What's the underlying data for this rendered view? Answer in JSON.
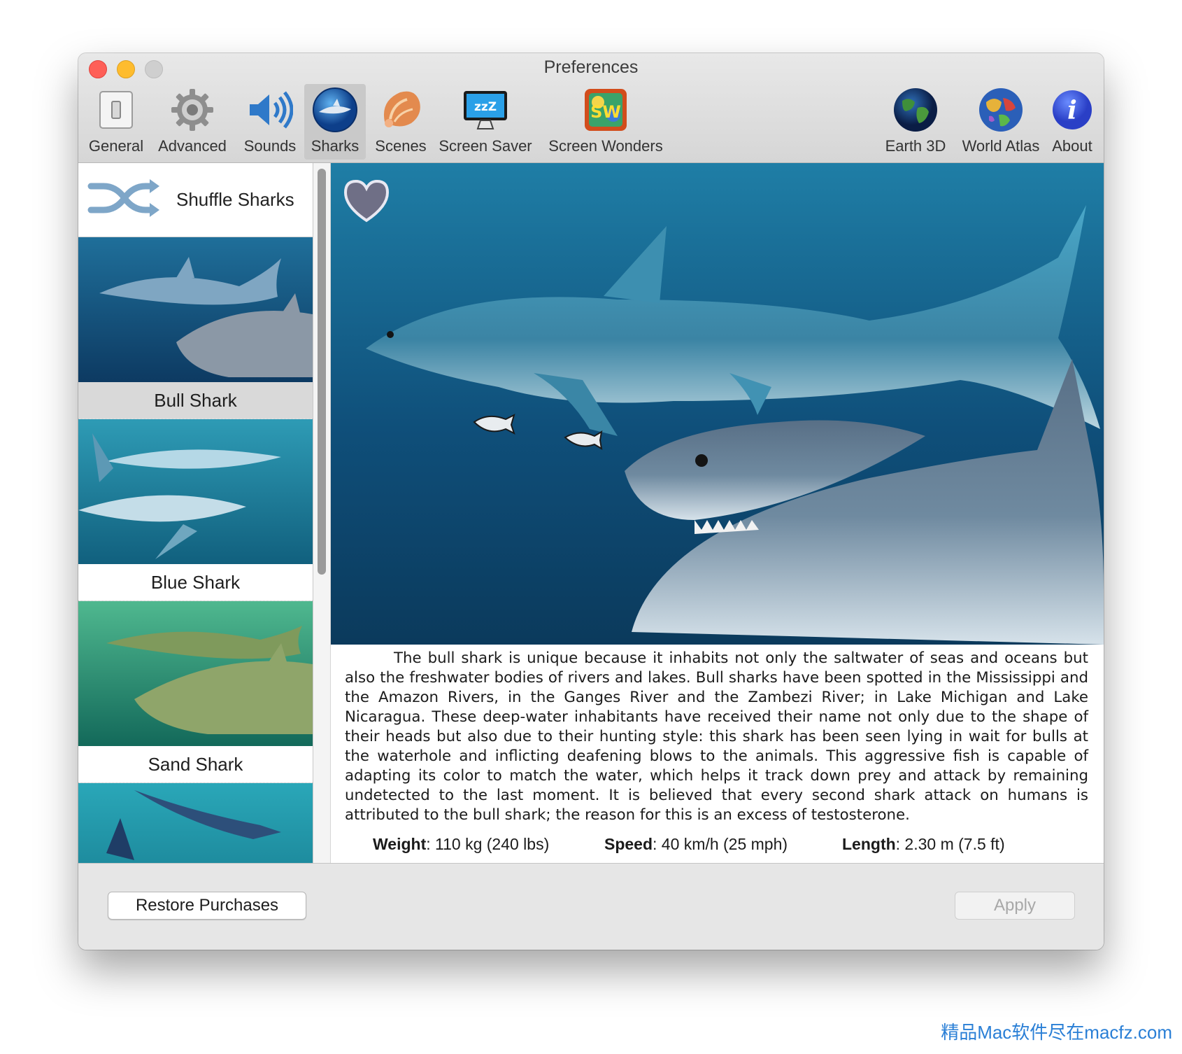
{
  "window": {
    "title": "Preferences"
  },
  "toolbar": {
    "items": [
      {
        "label": "General",
        "icon": "general-icon"
      },
      {
        "label": "Advanced",
        "icon": "gear-icon"
      },
      {
        "label": "Sounds",
        "icon": "speaker-icon"
      },
      {
        "label": "Sharks",
        "icon": "shark-icon",
        "selected": true
      },
      {
        "label": "Scenes",
        "icon": "seashell-icon"
      },
      {
        "label": "Screen Saver",
        "icon": "screen-saver-icon"
      },
      {
        "label": "Screen Wonders",
        "icon": "screen-wonders-icon"
      },
      {
        "label": "Earth 3D",
        "icon": "globe-icon"
      },
      {
        "label": "World Atlas",
        "icon": "atlas-globe-icon"
      },
      {
        "label": "About",
        "icon": "info-icon"
      }
    ]
  },
  "sidebar": {
    "shuffle_label": "Shuffle Sharks",
    "items": [
      {
        "name": "Bull Shark",
        "selected": true
      },
      {
        "name": "Blue Shark"
      },
      {
        "name": "Sand Shark"
      },
      {
        "name": ""
      }
    ]
  },
  "detail": {
    "description": "The bull shark is unique because it inhabits not only the saltwater of seas and oceans but also the freshwater bodies of rivers and lakes. Bull sharks have been spotted in the Mississippi and the Amazon Rivers, in the Ganges River and the Zambezi River; in Lake Michigan and Lake Nicaragua. These deep-water inhabitants have received their name not only due to the shape of their heads but also due to their hunting style: this shark has been seen lying in wait for bulls at the waterhole and inflicting deafening blows to the animals. This aggressive fish is capable of adapting its color to match the water, which helps it track down prey and attack by remaining undetected to the last moment. It is believed that every second shark attack on humans is attributed to the bull shark; the reason for this is an excess of testosterone.",
    "weight_label": "Weight",
    "weight_value": ": 110 kg (240 lbs)",
    "speed_label": "Speed",
    "speed_value": ": 40 km/h (25 mph)",
    "length_label": "Length",
    "length_value": ": 2.30 m (7.5 ft)"
  },
  "buttons": {
    "restore": "Restore Purchases",
    "apply": "Apply"
  },
  "watermark": "精品Mac软件尽在macfz.com",
  "colors": {
    "ocean_dark": "#0b3a5c",
    "ocean_light": "#1f7ea6",
    "accent_blue": "#2a7fd6"
  }
}
